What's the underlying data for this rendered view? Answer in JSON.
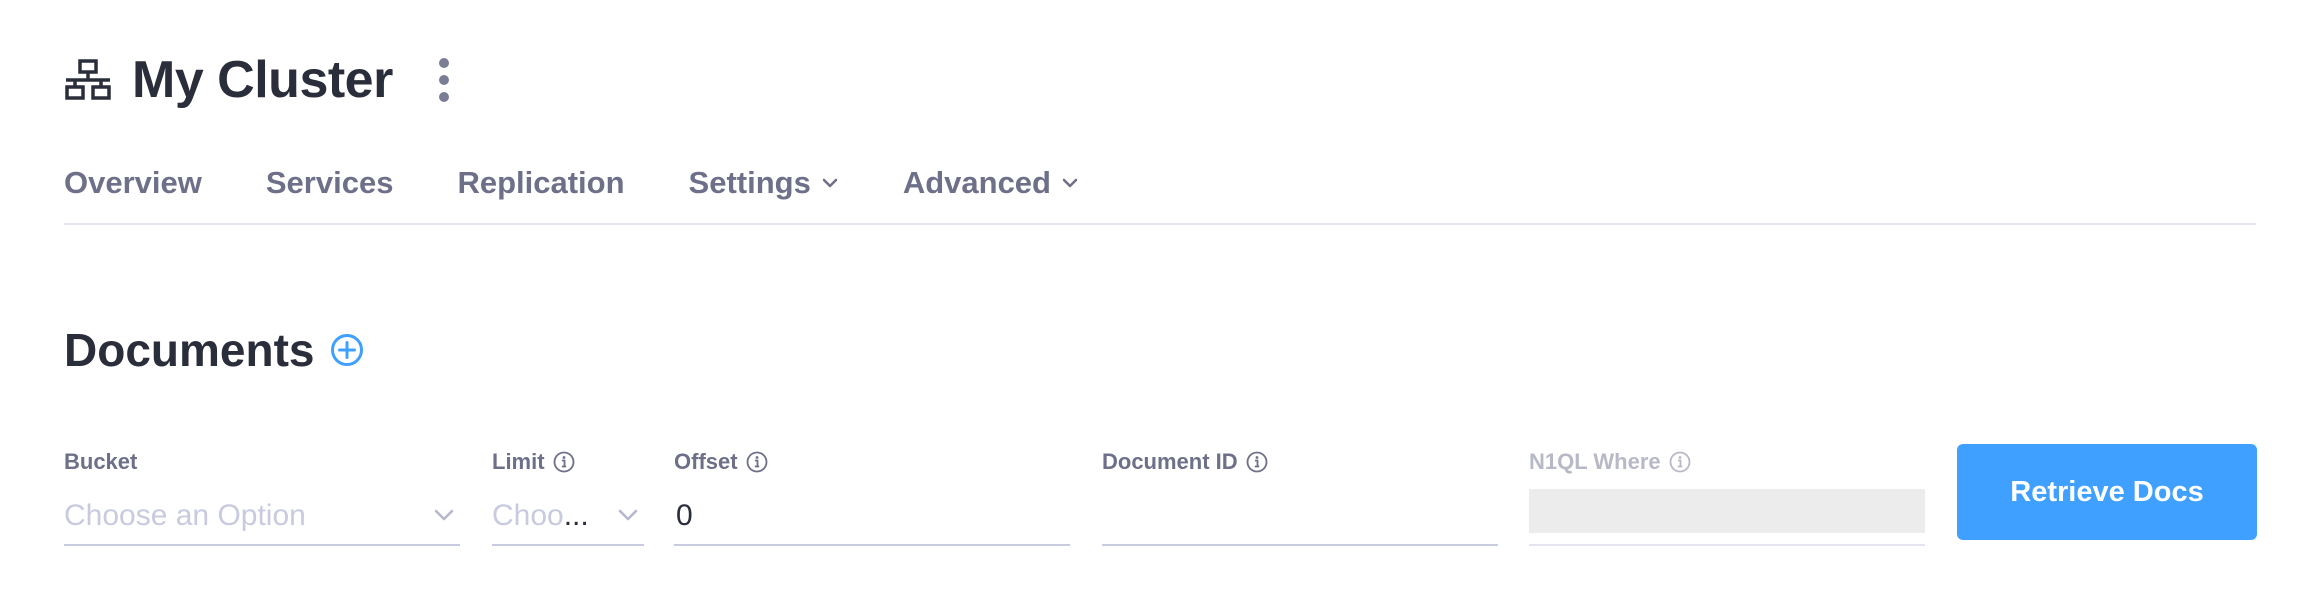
{
  "header": {
    "title": "My Cluster",
    "title_icon": "network-topology-icon",
    "menu_icon": "kebab-menu-icon"
  },
  "nav": {
    "items": [
      {
        "label": "Overview",
        "has_dropdown": false
      },
      {
        "label": "Services",
        "has_dropdown": false
      },
      {
        "label": "Replication",
        "has_dropdown": false
      },
      {
        "label": "Settings",
        "has_dropdown": true
      },
      {
        "label": "Advanced",
        "has_dropdown": true
      }
    ]
  },
  "section": {
    "title": "Documents",
    "add_icon": "plus-circle-icon"
  },
  "filters": {
    "bucket": {
      "label": "Bucket",
      "placeholder": "Choose an Option",
      "value": ""
    },
    "limit": {
      "label": "Limit",
      "placeholder": "Choo",
      "ellipsis": "...",
      "value": ""
    },
    "offset": {
      "label": "Offset",
      "value": "0"
    },
    "document_id": {
      "label": "Document ID",
      "value": ""
    },
    "n1ql_where": {
      "label": "N1QL Where",
      "value": "",
      "disabled": true
    }
  },
  "actions": {
    "retrieve_label": "Retrieve Docs"
  },
  "colors": {
    "accent": "#40a0ff",
    "heading": "#2a2d3a",
    "nav_text": "#6d7088",
    "placeholder": "#c8cadf"
  }
}
